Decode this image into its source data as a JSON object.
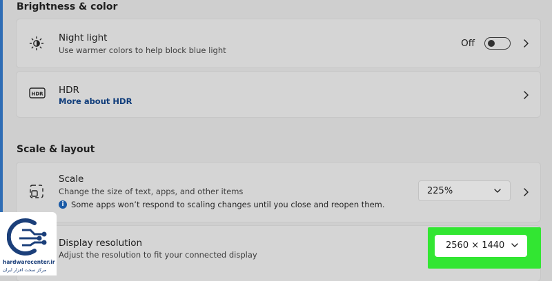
{
  "sections": {
    "brightness_title": "Brightness & color",
    "scale_title": "Scale & layout"
  },
  "night_light": {
    "title": "Night light",
    "subtitle": "Use warmer colors to help block blue light",
    "toggle_state": "Off",
    "icon": "brightness-sun-icon"
  },
  "hdr": {
    "title": "HDR",
    "link": "More about HDR",
    "icon": "hdr-icon"
  },
  "scale": {
    "title": "Scale",
    "subtitle": "Change the size of text, apps, and other items",
    "info": "Some apps won’t respond to scaling changes until you close and reopen them.",
    "value": "225%",
    "icon": "scale-icon"
  },
  "display_resolution": {
    "title": "Display resolution",
    "subtitle": "Adjust the resolution to fit your connected display",
    "value": "2560 × 1440"
  },
  "logo": {
    "brand": "hardwarecenter.ir",
    "brand_fa": "مرکز سخت افزار ایران"
  },
  "colors": {
    "background": "#cfcfcf",
    "card": "#d5d5d5",
    "link": "#0f3c7a",
    "highlight": "#32e632"
  }
}
